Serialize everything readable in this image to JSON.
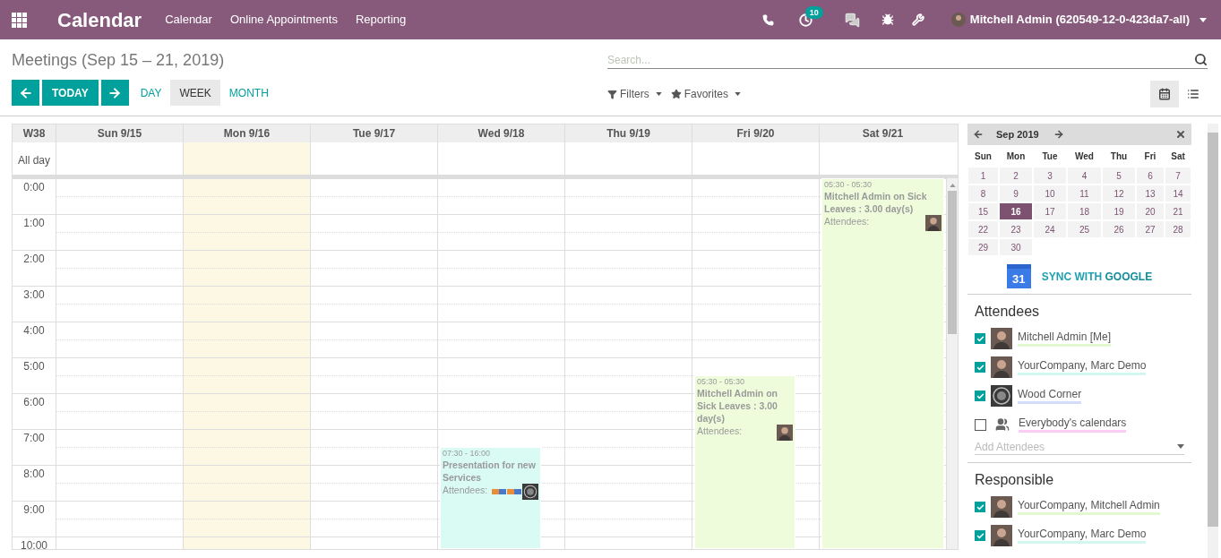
{
  "navbar": {
    "app_title": "Calendar",
    "menu": [
      "Calendar",
      "Online Appointments",
      "Reporting"
    ],
    "activity_badge": "10",
    "user": "Mitchell Admin (620549-12-0-423da7-all)"
  },
  "control_panel": {
    "title": "Meetings (Sep 15 – 21, 2019)",
    "search_placeholder": "Search...",
    "today": "TODAY",
    "views": [
      {
        "label": "DAY",
        "selected": false
      },
      {
        "label": "WEEK",
        "selected": true
      },
      {
        "label": "MONTH",
        "selected": false
      }
    ],
    "filters": "Filters",
    "favorites": "Favorites",
    "view_switcher": [
      {
        "kind": "calendar",
        "selected": true
      },
      {
        "kind": "list",
        "selected": false
      }
    ]
  },
  "calendar": {
    "week": "W38",
    "all_day": "All day",
    "hours": [
      "0:00",
      "1:00",
      "2:00",
      "3:00",
      "4:00",
      "5:00",
      "6:00",
      "7:00",
      "8:00",
      "9:00",
      "10:00"
    ],
    "days": [
      {
        "label": "Sun 9/15",
        "today": false
      },
      {
        "label": "Mon 9/16",
        "today": true
      },
      {
        "label": "Tue 9/17",
        "today": false
      },
      {
        "label": "Wed 9/18",
        "today": false,
        "events": [
          {
            "time": "07:30 - 16:00",
            "title": "Presentation for new Services",
            "attendees_label": "Attendees:",
            "continued": false,
            "color": "#d9fbf4",
            "attendees": [
              {
                "kind": "logo"
              },
              {
                "kind": "logo"
              },
              {
                "kind": "emblem"
              }
            ]
          }
        ]
      },
      {
        "label": "Thu 9/19",
        "today": false
      },
      {
        "label": "Fri 9/20",
        "today": false,
        "events": [
          {
            "time": "05:30 - 05:30",
            "title": "Mitchell Admin on Sick Leaves : 3.00 day(s)",
            "attendees_label": "Attendees:",
            "continued": false,
            "color": "#effcdc",
            "attendees": [
              {
                "kind": "person"
              }
            ]
          }
        ]
      },
      {
        "label": "Sat 9/21",
        "today": false,
        "events": [
          {
            "time": "05:30 - 05:30",
            "title": "Mitchell Admin on Sick Leaves : 3.00 day(s)",
            "attendees_label": "Attendees:",
            "continued": true,
            "color": "#effcdc",
            "attendees": [
              {
                "kind": "person"
              }
            ]
          }
        ]
      }
    ]
  },
  "sidebar": {
    "mini_calendar": {
      "month": "Sep 2019",
      "weekdays": [
        "Sun",
        "Mon",
        "Tue",
        "Wed",
        "Thu",
        "Fri",
        "Sat"
      ],
      "weeks": [
        [
          {
            "label": "1",
            "selected": false
          },
          {
            "label": "2",
            "selected": false
          },
          {
            "label": "3",
            "selected": false
          },
          {
            "label": "4",
            "selected": false
          },
          {
            "label": "5",
            "selected": false
          },
          {
            "label": "6",
            "selected": false
          },
          {
            "label": "7",
            "selected": false
          }
        ],
        [
          {
            "label": "8",
            "selected": false
          },
          {
            "label": "9",
            "selected": false
          },
          {
            "label": "10",
            "selected": false
          },
          {
            "label": "11",
            "selected": false
          },
          {
            "label": "12",
            "selected": false
          },
          {
            "label": "13",
            "selected": false
          },
          {
            "label": "14",
            "selected": false
          }
        ],
        [
          {
            "label": "15",
            "selected": false
          },
          {
            "label": "16",
            "selected": true
          },
          {
            "label": "17",
            "selected": false
          },
          {
            "label": "18",
            "selected": false
          },
          {
            "label": "19",
            "selected": false
          },
          {
            "label": "20",
            "selected": false
          },
          {
            "label": "21",
            "selected": false
          }
        ],
        [
          {
            "label": "22",
            "selected": false
          },
          {
            "label": "23",
            "selected": false
          },
          {
            "label": "24",
            "selected": false
          },
          {
            "label": "25",
            "selected": false
          },
          {
            "label": "26",
            "selected": false
          },
          {
            "label": "27",
            "selected": false
          },
          {
            "label": "28",
            "selected": false
          }
        ],
        [
          {
            "label": "29",
            "selected": false
          },
          {
            "label": "30",
            "selected": false
          }
        ]
      ]
    },
    "sync": {
      "icon_text": "31",
      "label": "SYNC WITH",
      "brand": "GOOGLE"
    },
    "sections": [
      {
        "title": "Attendees",
        "add_placeholder": "Add Attendees",
        "items": [
          {
            "name": "Mitchell Admin [Me]",
            "checked": true,
            "kind": "person",
            "color": "#e2f8cf"
          },
          {
            "name": "YourCompany, Marc Demo",
            "checked": true,
            "kind": "person",
            "color": "#d2f7ee"
          },
          {
            "name": "Wood Corner",
            "checked": true,
            "kind": "emblem",
            "color": "#d3dcfb"
          },
          {
            "name": "Everybody's calendars",
            "checked": false,
            "kind": "group",
            "color": "#fbcdf4"
          }
        ]
      },
      {
        "title": "Responsible",
        "items": [
          {
            "name": "YourCompany, Mitchell Admin",
            "checked": true,
            "kind": "person",
            "color": "#e2f8cf"
          },
          {
            "name": "YourCompany, Marc Demo",
            "checked": true,
            "kind": "person",
            "color": "#d2f7ee"
          }
        ]
      }
    ]
  }
}
